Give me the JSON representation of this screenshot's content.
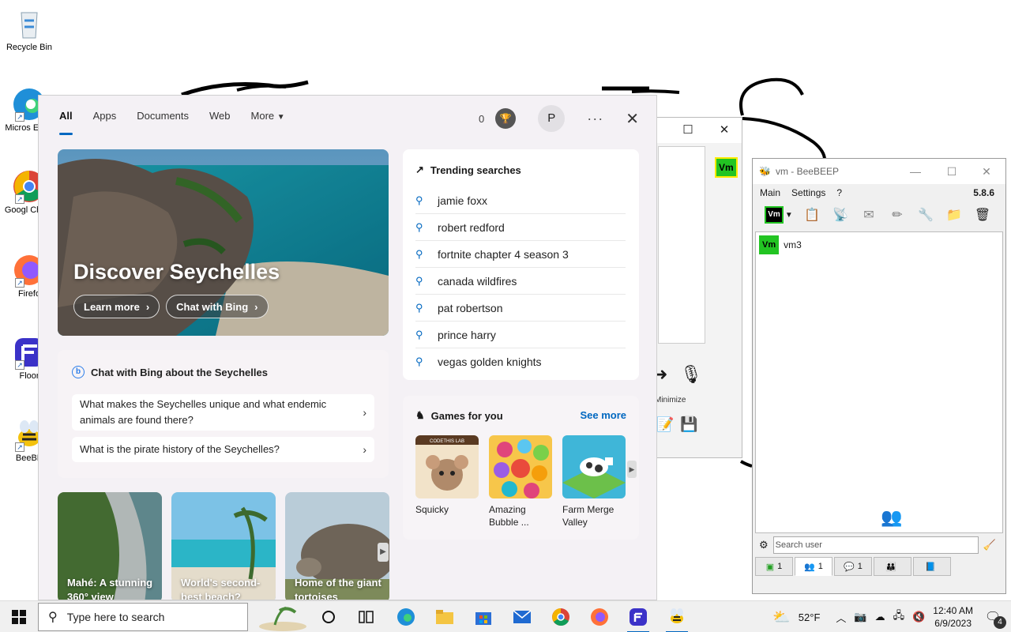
{
  "desktop": {
    "icons": [
      {
        "label": "Recycle Bin"
      },
      {
        "label": "Micros Edge"
      },
      {
        "label": "Googl Chron"
      },
      {
        "label": "Firefo"
      },
      {
        "label": "Floor"
      },
      {
        "label": "BeeBE"
      }
    ]
  },
  "search_flyout": {
    "tabs": [
      "All",
      "Apps",
      "Documents",
      "Web",
      "More"
    ],
    "points": "0",
    "avatar_initial": "P",
    "hero": {
      "title": "Discover Seychelles",
      "learn_more": "Learn more",
      "chat_with_bing": "Chat with Bing"
    },
    "bing_chat": {
      "heading": "Chat with Bing about the Seychelles",
      "questions": [
        "What makes the Seychelles unique and what endemic animals are found there?",
        "What is the pirate history of the Seychelles?"
      ]
    },
    "tiles": [
      {
        "title": "Mahé: A stunning 360° view"
      },
      {
        "title": "World's second-best beach?"
      },
      {
        "title": "Home of the giant tortoises"
      }
    ],
    "trending": {
      "heading": "Trending searches",
      "items": [
        "jamie foxx",
        "robert redford",
        "fortnite chapter 4 season 3",
        "canada wildfires",
        "pat robertson",
        "prince harry",
        "vegas golden knights"
      ]
    },
    "games": {
      "heading": "Games for you",
      "see_more": "See more",
      "items": [
        {
          "name": "Squicky",
          "badge": "CODETHIS LAB"
        },
        {
          "name": "Amazing Bubble ..."
        },
        {
          "name": "Farm Merge Valley"
        }
      ]
    }
  },
  "bg_window": {
    "badge": "Vm",
    "minimize_label": "Minimize"
  },
  "beebeep": {
    "title": "vm - BeeBEEP",
    "menu": [
      "Main",
      "Settings",
      "?"
    ],
    "version": "5.8.6",
    "toolbar_badge": "Vm",
    "users": [
      {
        "badge": "Vm",
        "name": "vm3"
      }
    ],
    "search_placeholder": "Search user",
    "tabs": [
      {
        "count": "1"
      },
      {
        "count": "1"
      },
      {
        "count": "1"
      },
      {
        "count": ""
      },
      {
        "count": ""
      }
    ]
  },
  "taskbar": {
    "search_placeholder": "Type here to search",
    "weather": "52°F",
    "time": "12:40 AM",
    "date": "6/9/2023",
    "notification_count": "4"
  },
  "colors": {
    "accent": "#0067c0",
    "vm_green": "#22c422",
    "vm_border": "#ffeb00"
  }
}
